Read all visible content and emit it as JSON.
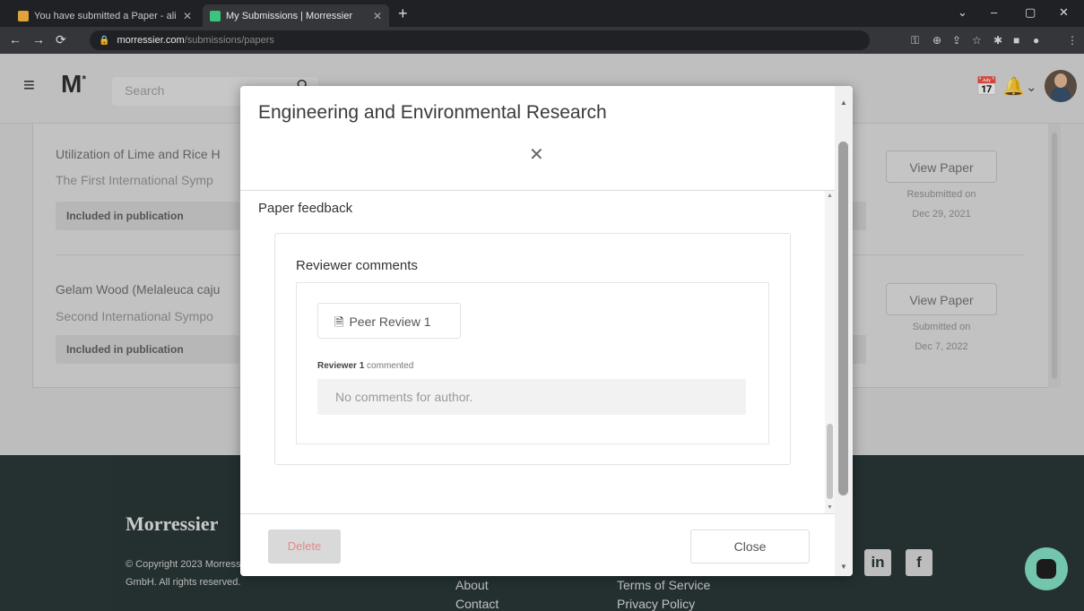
{
  "browser": {
    "tabs": [
      {
        "title": "You have submitted a Paper - ali",
        "favicon_color": "#e0a23a"
      },
      {
        "title": "My Submissions | Morressier",
        "favicon_color": "#3cc47c"
      }
    ],
    "new_tab": "+",
    "url_host": "morressier.com",
    "url_path": "/submissions/papers",
    "window_controls": [
      "⌄",
      "–",
      "▢",
      "✕"
    ]
  },
  "header": {
    "logo": "M",
    "logo_mark": "*",
    "search_placeholder": "Search"
  },
  "submissions": [
    {
      "title": "Utilization of Lime and Rice H",
      "event": "The First International Symp",
      "status": "Included in publication",
      "action": "View Paper",
      "date_label": "Resubmitted on",
      "date": "Dec 29, 2021"
    },
    {
      "title": "Gelam Wood (Melaleuca caju",
      "event": "Second International Sympo",
      "status": "Included in publication",
      "action": "View Paper",
      "date_label": "Submitted on",
      "date": "Dec 7, 2022"
    }
  ],
  "footer": {
    "brand": "Morressier",
    "copyright": "© Copyright 2023 Morressier GmbH. All rights reserved.",
    "links_col1": [
      "About",
      "Contact"
    ],
    "links_col2": [
      "Terms of Service",
      "Privacy Policy"
    ],
    "social": [
      "in",
      "f"
    ]
  },
  "modal": {
    "title": "Engineering and Environmental Research",
    "close_symbol": "✕",
    "section_label": "Paper feedback",
    "reviewer_comments_label": "Reviewer comments",
    "peer_review_label": "Peer Review 1",
    "reviewer_name": "Reviewer 1",
    "reviewer_action": "commented",
    "comment_text": "No comments for author.",
    "delete_label": "Delete",
    "close_label": "Close"
  },
  "colors": {
    "footer_bg": "#1c2a2a",
    "chat_accent": "#7ce0c3",
    "delete_text": "#e08a8a"
  }
}
